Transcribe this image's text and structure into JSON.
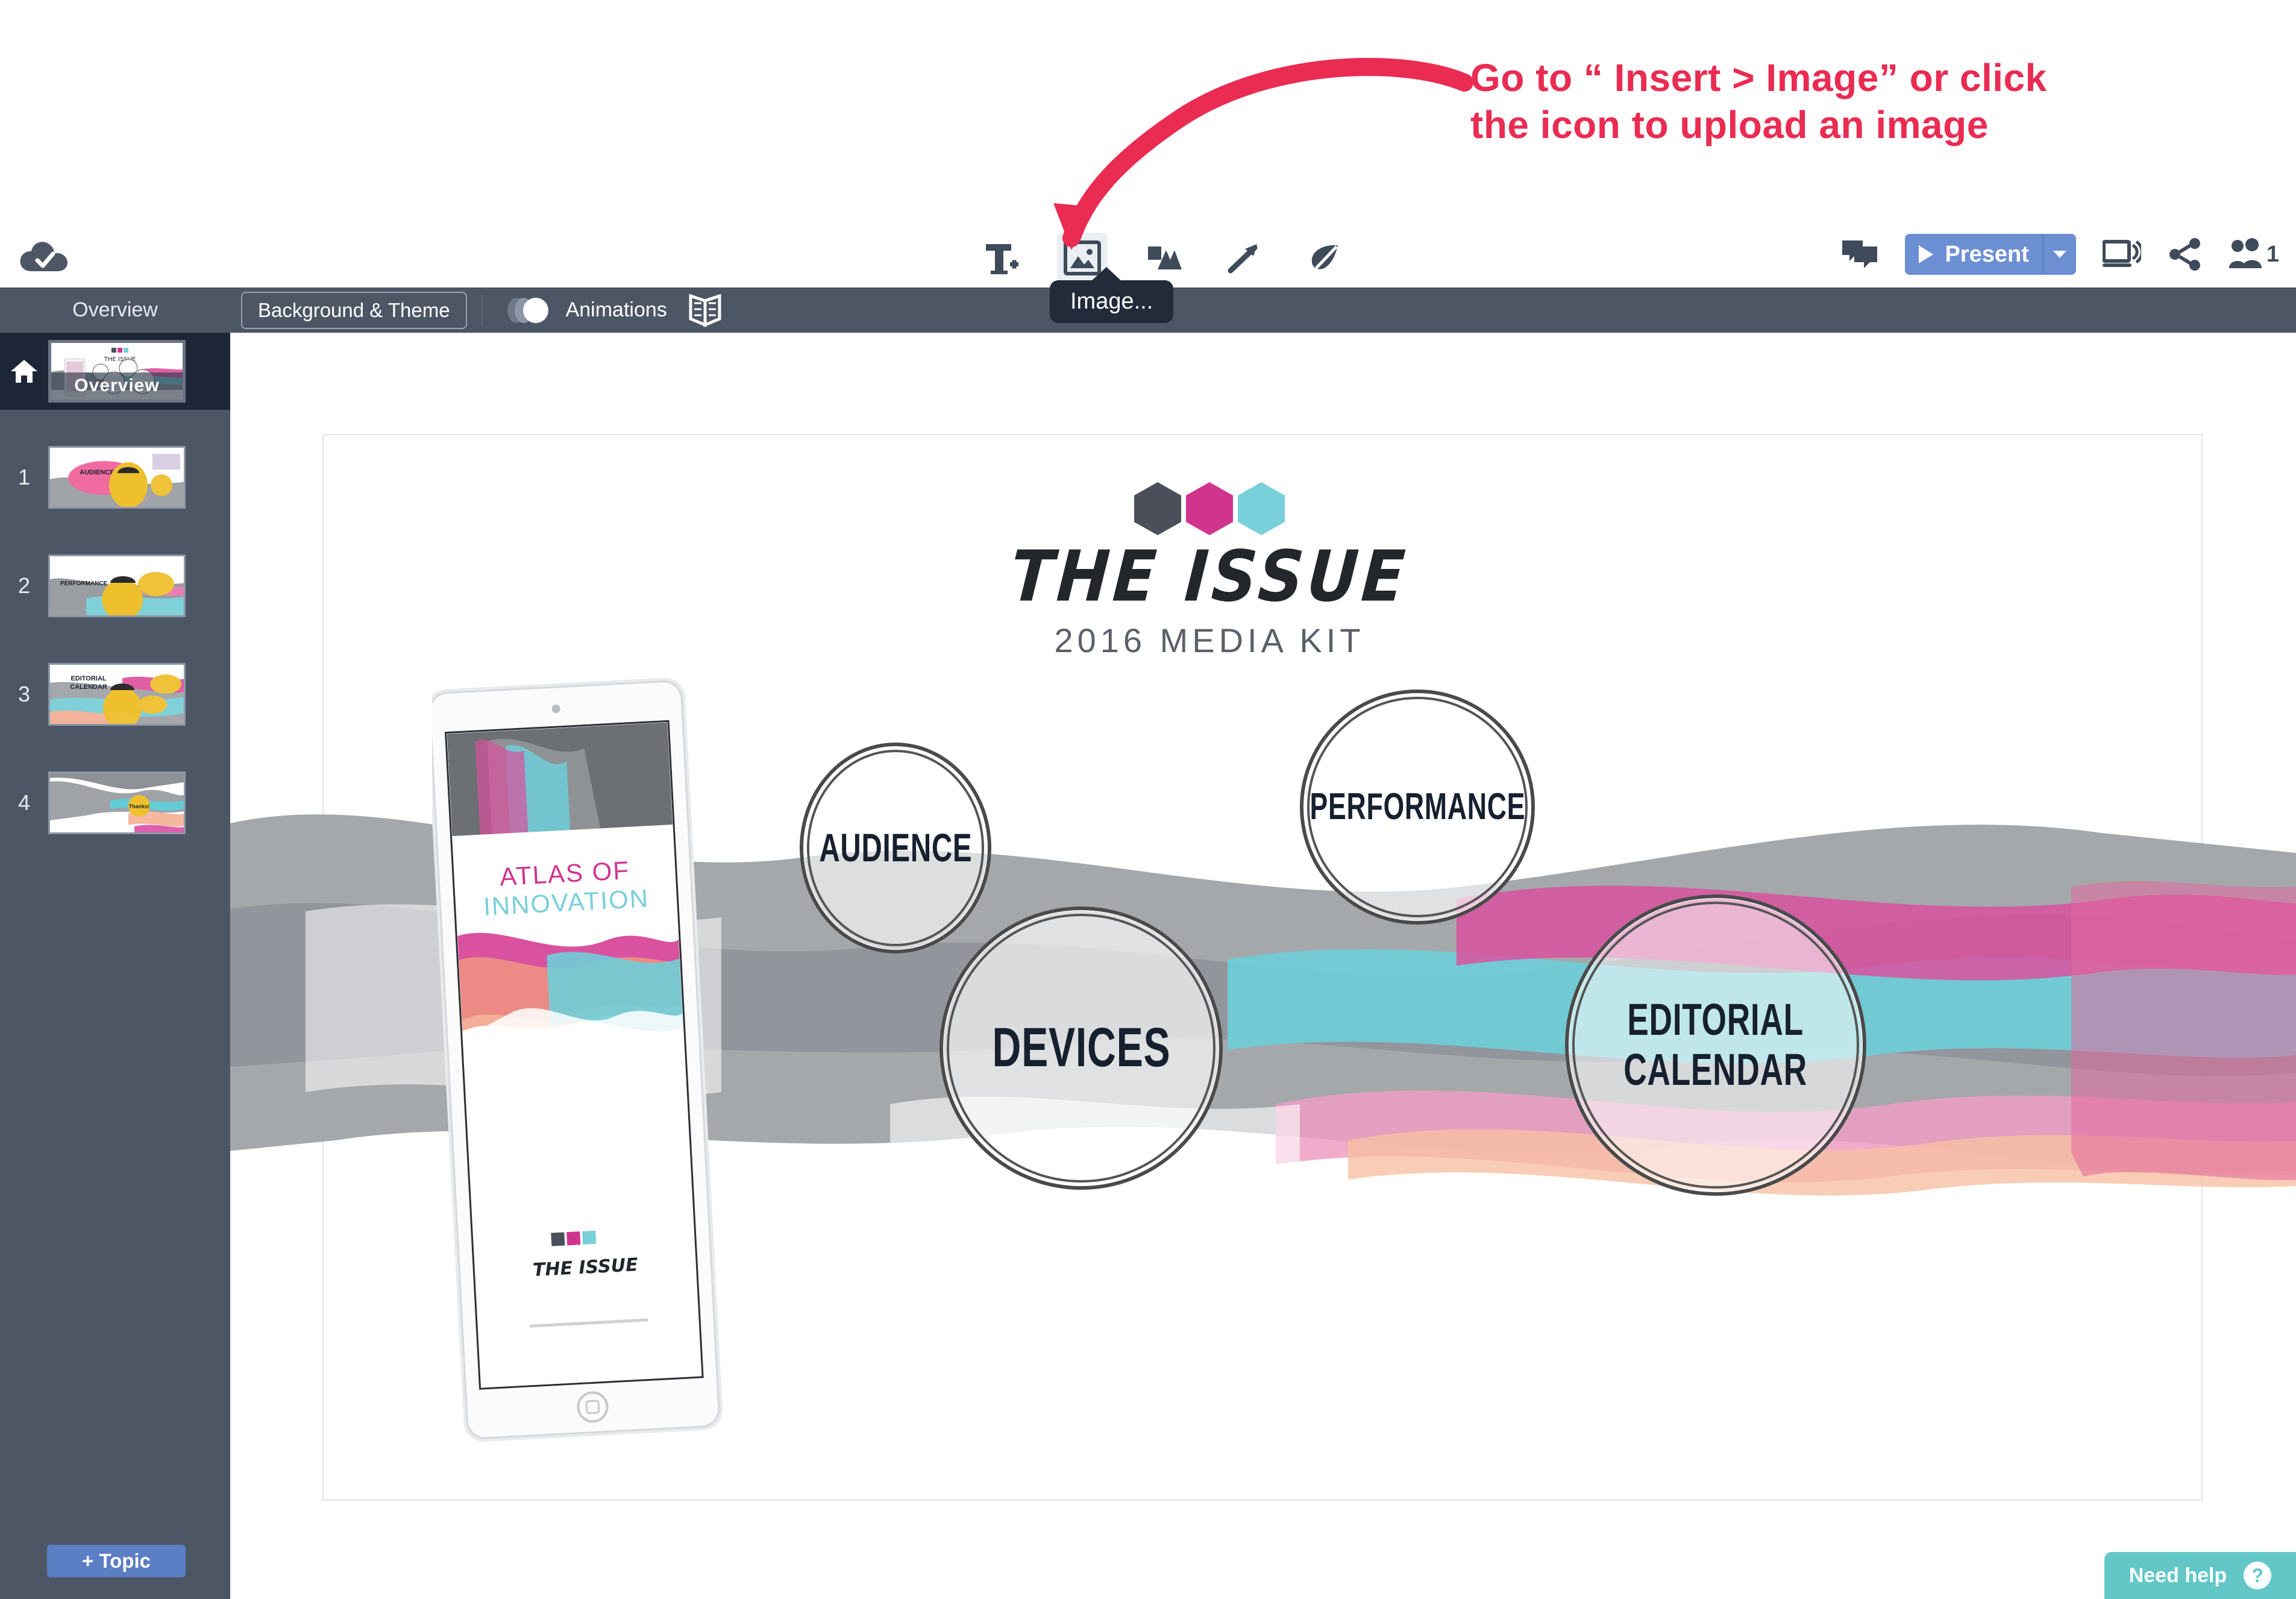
{
  "annotation": {
    "line1": "Go to “ Insert > Image” or click",
    "line2": "the icon to upload an image",
    "color": "#ea2b52"
  },
  "toolbar": {
    "saved_icon": "cloud-check-icon",
    "tools": [
      {
        "name": "text-tool",
        "icon": "text-plus-icon",
        "label": "Text",
        "active": false
      },
      {
        "name": "image-tool",
        "icon": "image-icon",
        "label": "Image",
        "active": true
      },
      {
        "name": "shape-tool",
        "icon": "shapes-icon",
        "label": "Shape",
        "active": false
      },
      {
        "name": "line-tool",
        "icon": "arrow-icon",
        "label": "Line",
        "active": false
      },
      {
        "name": "draw-tool",
        "icon": "leaf-icon",
        "label": "Draw",
        "active": false
      }
    ],
    "tooltip": "Image...",
    "comment_icon": "comment-icon",
    "present_label": "Present",
    "present_caret": "▼",
    "broadcast_icon": "broadcast-icon",
    "share_icon": "share-icon",
    "collaborators_icon": "people-icon",
    "collaborators_count": "1",
    "present_color": "#6c8fd4"
  },
  "secondary_toolbar": {
    "overview_tab": "Overview",
    "background_theme": "Background & Theme",
    "animations_label": "Animations",
    "animations_on": true,
    "spread_icon": "book-spread-icon"
  },
  "sidebar": {
    "home_icon": "home-icon",
    "overview": {
      "caption": "Overview",
      "selected": true
    },
    "slides": [
      {
        "number": "1",
        "title": "AUDIENCE"
      },
      {
        "number": "2",
        "title": "PERFORMANCE"
      },
      {
        "number": "3",
        "title": "EDITORIAL CALENDAR"
      },
      {
        "number": "4",
        "title": "Thanks!"
      }
    ],
    "add_topic": "+ Topic",
    "add_topic_color": "#5b7ec4"
  },
  "slide": {
    "logo": {
      "wordmark": "THE ISSUE",
      "subtitle": "2016 MEDIA KIT",
      "hex_colors": [
        "#4b4f5a",
        "#d1348f",
        "#79cfda"
      ]
    },
    "tablet": {
      "cover_title": "ATLAS OF INNOVATION",
      "cover_logo": "THE ISSUE"
    },
    "topics": [
      {
        "name": "audience",
        "label": "AUDIENCE"
      },
      {
        "name": "performance",
        "label": "PERFORMANCE"
      },
      {
        "name": "devices",
        "label": "DEVICES"
      },
      {
        "name": "editorial-calendar",
        "label": "EDITORIAL\nCALENDAR"
      }
    ]
  },
  "help": {
    "label": "Need help",
    "icon": "?",
    "color": "#62c7c6"
  }
}
